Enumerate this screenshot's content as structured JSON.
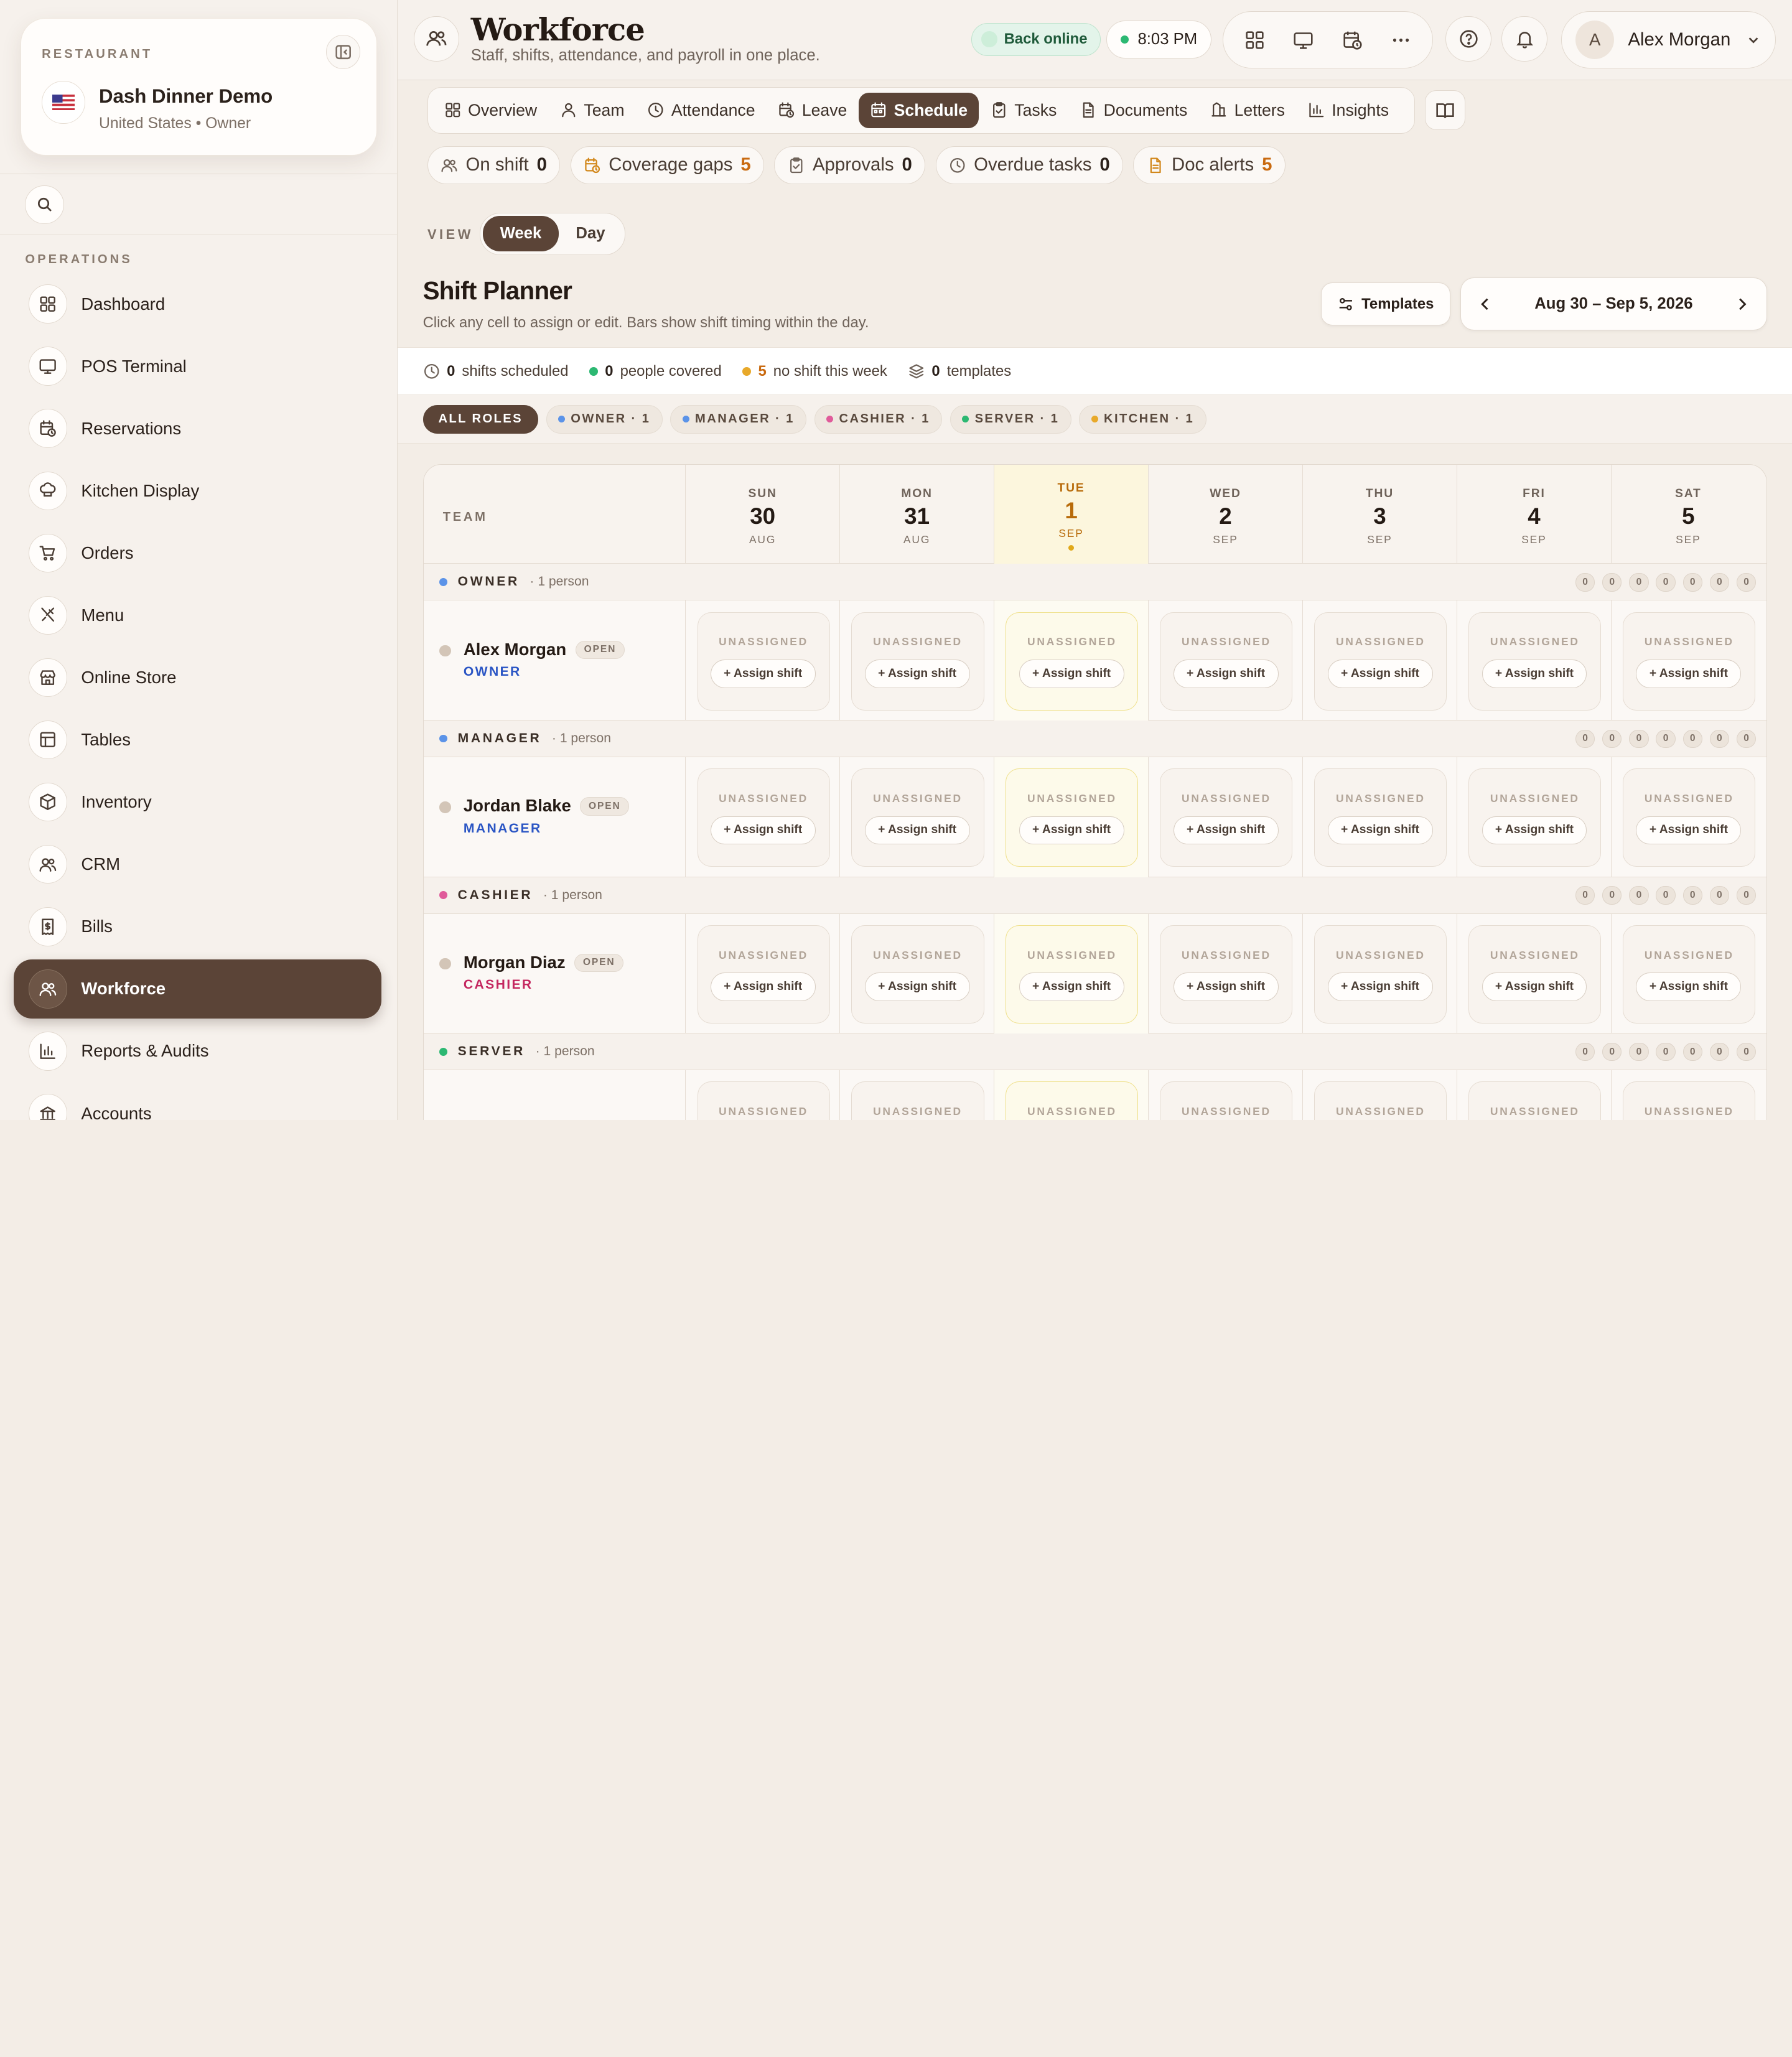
{
  "sidebar": {
    "restaurant_label": "RESTAURANT",
    "restaurant_name": "Dash Dinner Demo",
    "restaurant_sub": "United States • Owner",
    "flag_icon": "us-flag-icon",
    "operations_label": "OPERATIONS",
    "items": [
      {
        "label": "Dashboard",
        "icon": "grid-icon"
      },
      {
        "label": "POS Terminal",
        "icon": "monitor-icon"
      },
      {
        "label": "Reservations",
        "icon": "calendar-clock-icon"
      },
      {
        "label": "Kitchen Display",
        "icon": "chef-hat-icon"
      },
      {
        "label": "Orders",
        "icon": "cart-icon"
      },
      {
        "label": "Menu",
        "icon": "utensils-icon"
      },
      {
        "label": "Online Store",
        "icon": "store-icon"
      },
      {
        "label": "Tables",
        "icon": "table-icon"
      },
      {
        "label": "Inventory",
        "icon": "box-icon"
      },
      {
        "label": "CRM",
        "icon": "users-icon"
      },
      {
        "label": "Bills",
        "icon": "receipt-icon"
      },
      {
        "label": "Workforce",
        "icon": "users-icon",
        "active": true
      },
      {
        "label": "Reports & Audits",
        "icon": "bar-chart-icon"
      },
      {
        "label": "Accounts",
        "icon": "bank-icon"
      }
    ]
  },
  "header": {
    "title": "Workforce",
    "subtitle": "Staff, shifts, attendance, and payroll in one place.",
    "online_status": "Back online",
    "time": "8:03 PM",
    "user_initial": "A",
    "user_name": "Alex Morgan"
  },
  "tabs": [
    {
      "label": "Overview",
      "icon": "grid-icon"
    },
    {
      "label": "Team",
      "icon": "user-icon"
    },
    {
      "label": "Attendance",
      "icon": "clock-icon"
    },
    {
      "label": "Leave",
      "icon": "calendar-clock-icon"
    },
    {
      "label": "Schedule",
      "icon": "calendar-icon",
      "active": true
    },
    {
      "label": "Tasks",
      "icon": "clipboard-icon"
    },
    {
      "label": "Documents",
      "icon": "document-icon"
    },
    {
      "label": "Letters",
      "icon": "letter-icon"
    },
    {
      "label": "Insights",
      "icon": "bar-chart-icon"
    }
  ],
  "stats": [
    {
      "label": "On shift",
      "value": "0",
      "icon": "users-icon",
      "warn": false
    },
    {
      "label": "Coverage gaps",
      "value": "5",
      "icon": "calendar-clock-icon",
      "warn": true
    },
    {
      "label": "Approvals",
      "value": "0",
      "icon": "clipboard-icon",
      "warn": false
    },
    {
      "label": "Overdue tasks",
      "value": "0",
      "icon": "clock-icon",
      "warn": false
    },
    {
      "label": "Doc alerts",
      "value": "5",
      "icon": "document-icon",
      "warn": true
    }
  ],
  "view": {
    "label": "VIEW",
    "options": [
      "Week",
      "Day"
    ],
    "selected": "Week"
  },
  "planner": {
    "title": "Shift Planner",
    "subtitle": "Click any cell to assign or edit. Bars show shift timing within the day.",
    "templates_label": "Templates",
    "date_range": "Aug 30 – Sep 5, 2026"
  },
  "summary": [
    {
      "value": "0",
      "label": "shifts scheduled",
      "icon": "clock-icon",
      "color": ""
    },
    {
      "value": "0",
      "label": "people covered",
      "icon": "",
      "color": "#2cb872"
    },
    {
      "value": "5",
      "label": "no shift this week",
      "icon": "",
      "color": "#e8a92a"
    },
    {
      "value": "0",
      "label": "templates",
      "icon": "layers-icon",
      "color": ""
    }
  ],
  "role_filters": [
    {
      "label": "ALL ROLES",
      "color": "",
      "active": true
    },
    {
      "label": "OWNER · 1",
      "color": "#5b93e8"
    },
    {
      "label": "MANAGER · 1",
      "color": "#5b93e8"
    },
    {
      "label": "CASHIER · 1",
      "color": "#e05b9a"
    },
    {
      "label": "SERVER · 1",
      "color": "#2cb872"
    },
    {
      "label": "KITCHEN · 1",
      "color": "#e8a92a"
    }
  ],
  "grid": {
    "team_header": "TEAM",
    "days": [
      {
        "dow": "SUN",
        "num": "30",
        "mon": "AUG"
      },
      {
        "dow": "MON",
        "num": "31",
        "mon": "AUG"
      },
      {
        "dow": "TUE",
        "num": "1",
        "mon": "SEP",
        "today": true
      },
      {
        "dow": "WED",
        "num": "2",
        "mon": "SEP"
      },
      {
        "dow": "THU",
        "num": "3",
        "mon": "SEP"
      },
      {
        "dow": "FRI",
        "num": "4",
        "mon": "SEP"
      },
      {
        "dow": "SAT",
        "num": "5",
        "mon": "SEP"
      }
    ],
    "unassigned_label": "UNASSIGNED",
    "assign_label": "+ Assign shift",
    "open_label": "OPEN",
    "groups": [
      {
        "name": "OWNER",
        "count": "· 1 person",
        "color": "#5b93e8",
        "counts": [
          "0",
          "0",
          "0",
          "0",
          "0",
          "0",
          "0"
        ],
        "person": {
          "name": "Alex Morgan",
          "role": "OWNER",
          "role_color": "#2a55c4"
        }
      },
      {
        "name": "MANAGER",
        "count": "· 1 person",
        "color": "#5b93e8",
        "counts": [
          "0",
          "0",
          "0",
          "0",
          "0",
          "0",
          "0"
        ],
        "person": {
          "name": "Jordan Blake",
          "role": "MANAGER",
          "role_color": "#2a55c4"
        }
      },
      {
        "name": "CASHIER",
        "count": "· 1 person",
        "color": "#e05b9a",
        "counts": [
          "0",
          "0",
          "0",
          "0",
          "0",
          "0",
          "0"
        ],
        "person": {
          "name": "Morgan Diaz",
          "role": "CASHIER",
          "role_color": "#c4275f"
        }
      },
      {
        "name": "SERVER",
        "count": "· 1 person",
        "color": "#2cb872",
        "counts": [
          "0",
          "0",
          "0",
          "0",
          "0",
          "0",
          "0"
        ],
        "person": {
          "name": "",
          "role": "",
          "role_color": "#1f8a55"
        }
      }
    ]
  }
}
